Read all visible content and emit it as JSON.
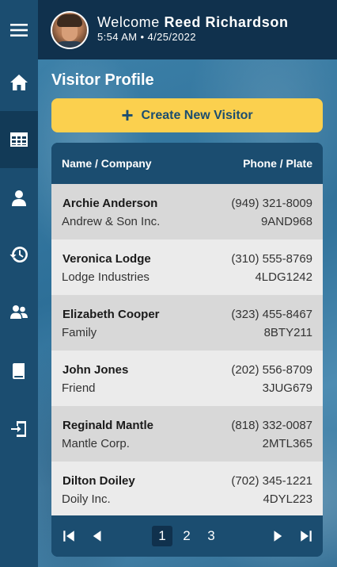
{
  "header": {
    "welcome_prefix": "Welcome",
    "user_name": "Reed Richardson",
    "datetime": "5:54 AM • 4/25/2022"
  },
  "page": {
    "title": "Visitor Profile",
    "create_button": "Create New Visitor",
    "create_icon": "+"
  },
  "sidebar": {
    "items": [
      {
        "icon": "hamburger-icon"
      },
      {
        "icon": "home-icon"
      },
      {
        "icon": "table-icon",
        "active": true
      },
      {
        "icon": "person-icon"
      },
      {
        "icon": "history-icon"
      },
      {
        "icon": "people-icon"
      },
      {
        "icon": "book-icon"
      },
      {
        "icon": "logout-icon"
      }
    ]
  },
  "table": {
    "col_name": "Name / Company",
    "col_phone": "Phone / Plate",
    "rows": [
      {
        "name": "Archie Anderson",
        "company": "Andrew & Son Inc.",
        "phone": "(949) 321-8009",
        "plate": "9AND968"
      },
      {
        "name": "Veronica Lodge",
        "company": "Lodge Industries",
        "phone": "(310) 555-8769",
        "plate": "4LDG1242"
      },
      {
        "name": "Elizabeth Cooper",
        "company": "Family",
        "phone": "(323) 455-8467",
        "plate": "8BTY211"
      },
      {
        "name": "John Jones",
        "company": "Friend",
        "phone": "(202) 556-8709",
        "plate": "3JUG679"
      },
      {
        "name": "Reginald Mantle",
        "company": "Mantle Corp.",
        "phone": "(818) 332-0087",
        "plate": "2MTL365"
      },
      {
        "name": "Dilton Doiley",
        "company": "Doily Inc.",
        "phone": "(702) 345-1221",
        "plate": "4DYL223"
      }
    ]
  },
  "pagination": {
    "pages": [
      "1",
      "2",
      "3"
    ],
    "current": "1"
  },
  "colors": {
    "sidebar": "#1b4d70",
    "header": "#10314d",
    "accent_button": "#fbd04e",
    "table_header": "#1b4d70"
  }
}
